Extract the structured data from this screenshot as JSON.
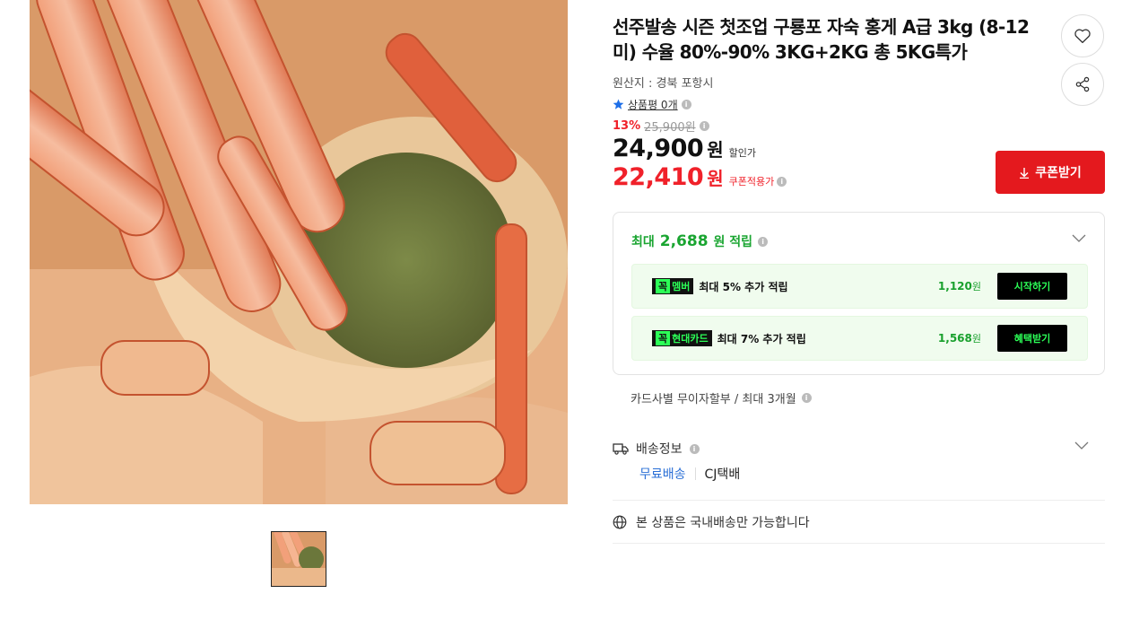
{
  "product": {
    "title": "선주발송 시즌 첫조업 구룡포 자숙 홍게 A급 3kg (8-12미) 수율 80%-90% 3KG+2KG 총 5KG특가",
    "origin": "원산지 : 경북 포항시",
    "review_label": "상품평 0개",
    "discount_rate": "13%",
    "original_price": "25,900원",
    "sale_price": "24,900",
    "sale_won": "원",
    "sale_tag": "할인가",
    "coupon_price": "22,410",
    "coupon_won": "원",
    "coupon_tag": "쿠폰적용가",
    "coupon_button": "쿠폰받기"
  },
  "points": {
    "prefix": "최대",
    "amount": "2,688",
    "suffix": "원 적립",
    "benefits": [
      {
        "tag_pre": "꼭",
        "tag": "멤버",
        "text": "최대 5% 추가 적립",
        "amount": "1,120",
        "unit": "원",
        "button": "시작하기"
      },
      {
        "tag_pre": "꼭",
        "tag": "현대카드",
        "text": "최대 7% 추가 적립",
        "amount": "1,568",
        "unit": "원",
        "button": "혜택받기"
      }
    ]
  },
  "installment": "카드사별 무이자할부 / 최대 3개월",
  "shipping": {
    "title": "배송정보",
    "free": "무료배송",
    "courier": "CJ택배"
  },
  "domestic_note": "본 상품은 국내배송만 가능합니다",
  "colors": {
    "accent_red": "#e4191e",
    "price_red": "#f0212a",
    "points_green": "#1aa531",
    "link_blue": "#2a6fd6"
  },
  "icons": [
    "heart-icon",
    "share-icon",
    "star-icon",
    "info-icon",
    "chevron-down-icon",
    "download-icon",
    "truck-icon",
    "globe-icon"
  ]
}
